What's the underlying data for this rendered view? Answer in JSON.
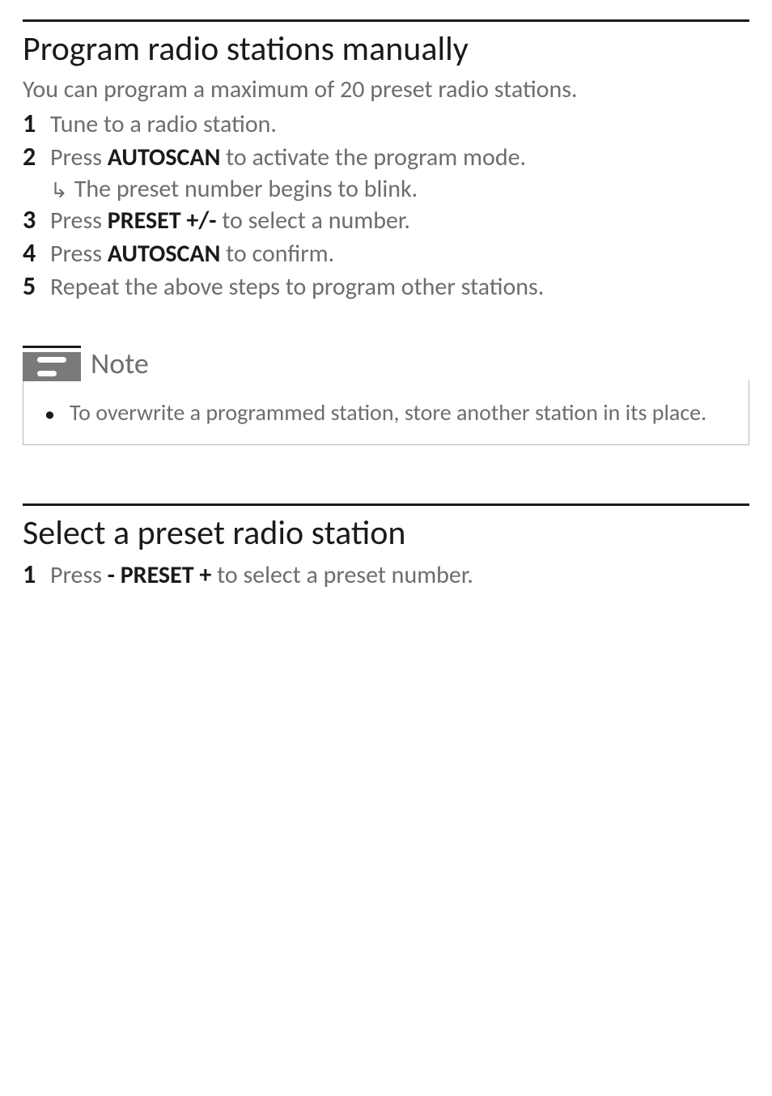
{
  "section1": {
    "title": "Program radio stations manually",
    "intro": "You can program a maximum of 20 preset radio stations.",
    "steps": {
      "s1": {
        "num": "1",
        "text": "Tune to a radio station."
      },
      "s2": {
        "num": "2",
        "pre": "Press ",
        "bold": "AUTOSCAN",
        "post": " to activate the program mode.",
        "sub": "The preset number begins to blink."
      },
      "s3": {
        "num": "3",
        "pre": "Press ",
        "bold": "PRESET +/-",
        "post": " to select a number."
      },
      "s4": {
        "num": "4",
        "pre": "Press ",
        "bold": "AUTOSCAN",
        "post": " to confirm."
      },
      "s5": {
        "num": "5",
        "text": "Repeat the above steps to program other stations."
      }
    }
  },
  "note": {
    "title": "Note",
    "body": "To overwrite a programmed station, store another station in its place."
  },
  "section2": {
    "title": "Select a preset radio station",
    "steps": {
      "s1": {
        "num": "1",
        "pre": "Press ",
        "bold": "- PRESET +",
        "post": " to select a preset number."
      }
    }
  }
}
